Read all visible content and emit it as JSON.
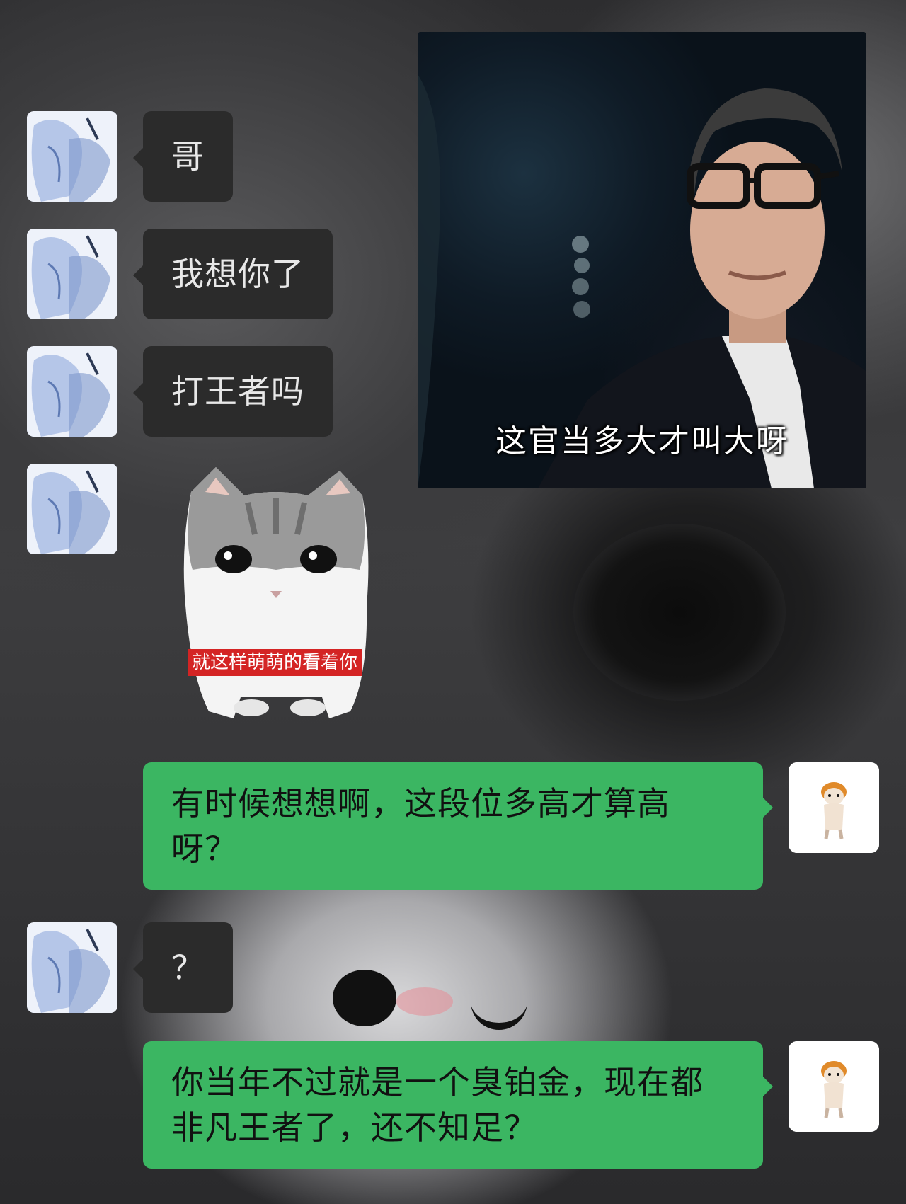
{
  "chat": {
    "messages": [
      {
        "from": "other",
        "type": "text",
        "text": "哥"
      },
      {
        "from": "other",
        "type": "text",
        "text": "我想你了"
      },
      {
        "from": "other",
        "type": "text",
        "text": "打王者吗"
      },
      {
        "from": "other",
        "type": "sticker",
        "caption": "就这样萌萌的看着你",
        "sticker_icon": "sad-cat-sticker"
      },
      {
        "from": "me",
        "type": "text",
        "text": "有时候想想啊，这段位多高才算高呀？"
      },
      {
        "from": "other",
        "type": "text",
        "text": "？"
      },
      {
        "from": "me",
        "type": "text",
        "text": "你当年不过就是一个臭铂金，现在都非凡王者了，还不知足？"
      }
    ],
    "meme_image": {
      "caption": "这官当多大才叫大呀",
      "icon": "man-with-glasses-photo"
    },
    "colors": {
      "bubble_other": "#2b2b2b",
      "bubble_me": "#3bb662",
      "text_other": "#e8e8e8",
      "text_me": "#111111",
      "sticker_caption_bg": "#d42424"
    }
  }
}
